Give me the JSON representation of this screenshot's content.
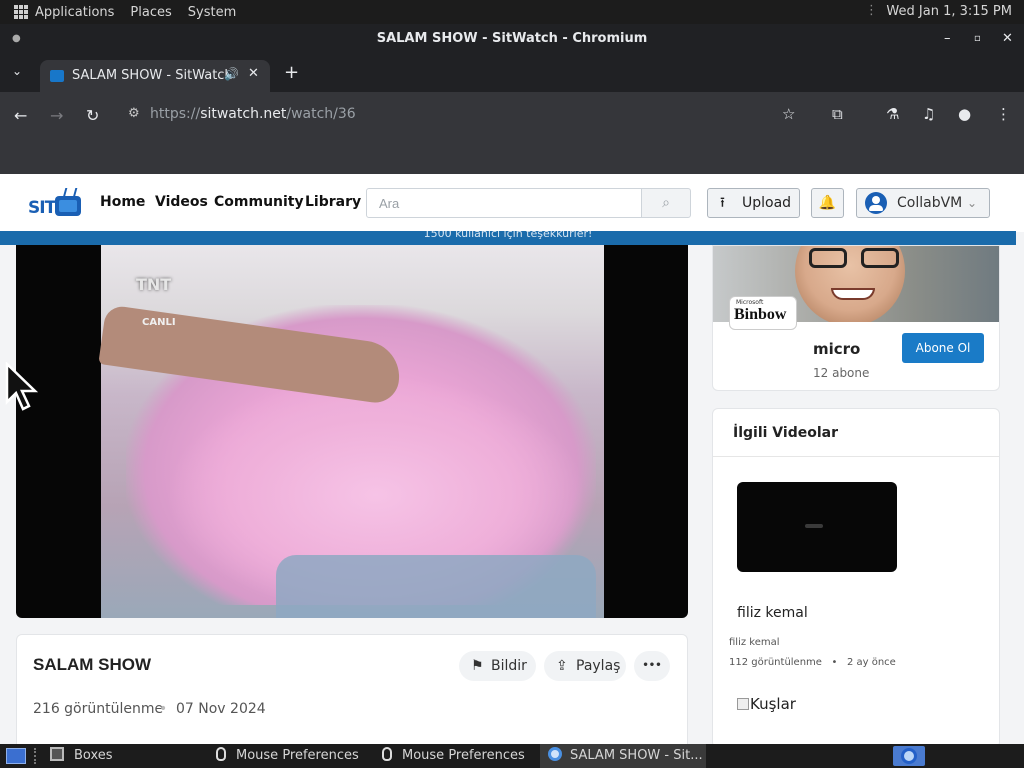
{
  "desktop": {
    "top_panel": {
      "menus": [
        "Applications",
        "Places",
        "System"
      ],
      "clock": "Wed Jan  1,  3:15 PM"
    },
    "taskbar": {
      "tasks": [
        {
          "label": "Boxes",
          "icon": "boxes-icon"
        },
        {
          "label": "Mouse Preferences",
          "icon": "mouse-icon"
        },
        {
          "label": "Mouse Preferences",
          "icon": "mouse-icon"
        },
        {
          "label": "SALAM SHOW - Sit...",
          "icon": "chromium-icon",
          "active": true
        }
      ]
    }
  },
  "browser": {
    "window_title": "SALAM SHOW - SitWatch - Chromium",
    "tab": {
      "title": "SALAM SHOW - SitWatch",
      "audio_icon": "speaker-icon",
      "close": "✕"
    },
    "new_tab": "+",
    "url": {
      "scheme": "https://",
      "host": "sitwatch.net",
      "path": "/watch/36"
    }
  },
  "site": {
    "logo_text": "SIT",
    "nav": [
      "Home",
      "Videos",
      "Community",
      "Library"
    ],
    "search": {
      "placeholder": "Ara",
      "value": ""
    },
    "upload_label": "Upload",
    "user_name": "CollabVM",
    "announcement": "1500 kullanıcı için teşekkürler!",
    "video": {
      "overlay_logo": "TNT",
      "overlay_sub": "CANLI",
      "title": "SALAM SHOW",
      "report_label": "Bildir",
      "share_label": "Paylaş",
      "more_label": "•••",
      "views": "216 görüntülenme",
      "date": "07 Nov 2024"
    },
    "channel": {
      "avatar_small": "Microsoft",
      "avatar_text": "Binbow",
      "name": "micro",
      "subscribers": "12 abone",
      "subscribe_label": "Abone Ol"
    },
    "related": {
      "heading": "İlgili Videolar",
      "items": [
        {
          "title": "filiz kemal",
          "channel": "filiz kemal",
          "views": "112 görüntülenme",
          "sep": "•",
          "age": "2 ay önce"
        },
        {
          "title": "Kuşlar"
        }
      ]
    }
  },
  "colors": {
    "accent": "#1a7bc7",
    "brand": "#1a5fb4",
    "announce_bar": "#1a6bab"
  }
}
